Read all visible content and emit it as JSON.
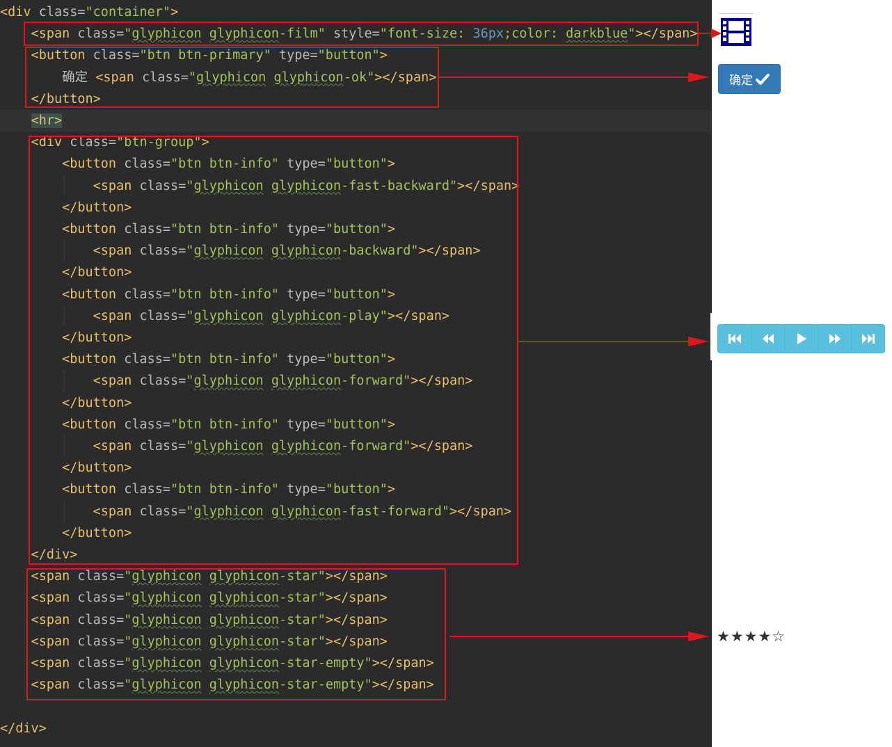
{
  "code_lines": [
    [
      [
        "t",
        "<div "
      ],
      [
        "a",
        "class="
      ],
      [
        "s",
        "\"container\""
      ],
      [
        "t",
        ">"
      ]
    ],
    [
      [
        "t",
        "    <span "
      ],
      [
        "a",
        "class="
      ],
      [
        "s",
        "\""
      ],
      [
        "sw",
        "glyphicon"
      ],
      [
        "s",
        " "
      ],
      [
        "sw",
        "glyphicon"
      ],
      [
        "s",
        "-film\""
      ],
      [
        "a",
        " style="
      ],
      [
        "s",
        "\"font-size: "
      ],
      [
        "n",
        "36px"
      ],
      [
        "s",
        ";color: "
      ],
      [
        "sw",
        "darkblue"
      ],
      [
        "s",
        "\""
      ],
      [
        "t",
        "></span>"
      ]
    ],
    [
      [
        "t",
        "    <button "
      ],
      [
        "a",
        "class="
      ],
      [
        "s",
        "\"btn btn-primary\""
      ],
      [
        "a",
        " type="
      ],
      [
        "s",
        "\"button\""
      ],
      [
        "t",
        ">"
      ]
    ],
    [
      [
        "p",
        "        确定 "
      ],
      [
        "t",
        "<span "
      ],
      [
        "a",
        "class="
      ],
      [
        "s",
        "\""
      ],
      [
        "sw",
        "glyphicon"
      ],
      [
        "s",
        " "
      ],
      [
        "sw",
        "glyphicon"
      ],
      [
        "s",
        "-ok\""
      ],
      [
        "t",
        "></span>"
      ]
    ],
    [
      [
        "t",
        "    </button>"
      ]
    ],
    [
      [
        "p",
        "    "
      ],
      [
        "hr",
        "<hr>"
      ]
    ],
    [
      [
        "t",
        "    <div "
      ],
      [
        "a",
        "class="
      ],
      [
        "s",
        "\"btn-group\""
      ],
      [
        "t",
        ">"
      ]
    ],
    [
      [
        "t",
        "        <button "
      ],
      [
        "a",
        "class="
      ],
      [
        "s",
        "\"btn btn-info\""
      ],
      [
        "a",
        " type="
      ],
      [
        "s",
        "\"button\""
      ],
      [
        "t",
        ">"
      ]
    ],
    [
      [
        "t",
        "            <span "
      ],
      [
        "a",
        "class="
      ],
      [
        "s",
        "\""
      ],
      [
        "sw",
        "glyphicon"
      ],
      [
        "s",
        " "
      ],
      [
        "sw",
        "glyphicon"
      ],
      [
        "s",
        "-fast-backward\""
      ],
      [
        "t",
        "></span>"
      ]
    ],
    [
      [
        "t",
        "        </button>"
      ]
    ],
    [
      [
        "t",
        "        <button "
      ],
      [
        "a",
        "class="
      ],
      [
        "s",
        "\"btn btn-info\""
      ],
      [
        "a",
        " type="
      ],
      [
        "s",
        "\"button\""
      ],
      [
        "t",
        ">"
      ]
    ],
    [
      [
        "t",
        "            <span "
      ],
      [
        "a",
        "class="
      ],
      [
        "s",
        "\""
      ],
      [
        "sw",
        "glyphicon"
      ],
      [
        "s",
        " "
      ],
      [
        "sw",
        "glyphicon"
      ],
      [
        "s",
        "-backward\""
      ],
      [
        "t",
        "></span>"
      ]
    ],
    [
      [
        "t",
        "        </button>"
      ]
    ],
    [
      [
        "t",
        "        <button "
      ],
      [
        "a",
        "class="
      ],
      [
        "s",
        "\"btn btn-info\""
      ],
      [
        "a",
        " type="
      ],
      [
        "s",
        "\"button\""
      ],
      [
        "t",
        ">"
      ]
    ],
    [
      [
        "t",
        "            <span "
      ],
      [
        "a",
        "class="
      ],
      [
        "s",
        "\""
      ],
      [
        "sw",
        "glyphicon"
      ],
      [
        "s",
        " "
      ],
      [
        "sw",
        "glyphicon"
      ],
      [
        "s",
        "-play\""
      ],
      [
        "t",
        "></span>"
      ]
    ],
    [
      [
        "t",
        "        </button>"
      ]
    ],
    [
      [
        "t",
        "        <button "
      ],
      [
        "a",
        "class="
      ],
      [
        "s",
        "\"btn btn-info\""
      ],
      [
        "a",
        " type="
      ],
      [
        "s",
        "\"button\""
      ],
      [
        "t",
        ">"
      ]
    ],
    [
      [
        "t",
        "            <span "
      ],
      [
        "a",
        "class="
      ],
      [
        "s",
        "\""
      ],
      [
        "sw",
        "glyphicon"
      ],
      [
        "s",
        " "
      ],
      [
        "sw",
        "glyphicon"
      ],
      [
        "s",
        "-forward\""
      ],
      [
        "t",
        "></span>"
      ]
    ],
    [
      [
        "t",
        "        </button>"
      ]
    ],
    [
      [
        "t",
        "        <button "
      ],
      [
        "a",
        "class="
      ],
      [
        "s",
        "\"btn btn-info\""
      ],
      [
        "a",
        " type="
      ],
      [
        "s",
        "\"button\""
      ],
      [
        "t",
        ">"
      ]
    ],
    [
      [
        "t",
        "            <span "
      ],
      [
        "a",
        "class="
      ],
      [
        "s",
        "\""
      ],
      [
        "sw",
        "glyphicon"
      ],
      [
        "s",
        " "
      ],
      [
        "sw",
        "glyphicon"
      ],
      [
        "s",
        "-forward\""
      ],
      [
        "t",
        "></span>"
      ]
    ],
    [
      [
        "t",
        "        </button>"
      ]
    ],
    [
      [
        "t",
        "        <button "
      ],
      [
        "a",
        "class="
      ],
      [
        "s",
        "\"btn btn-info\""
      ],
      [
        "a",
        " type="
      ],
      [
        "s",
        "\"button\""
      ],
      [
        "t",
        ">"
      ]
    ],
    [
      [
        "t",
        "            <span "
      ],
      [
        "a",
        "class="
      ],
      [
        "s",
        "\""
      ],
      [
        "sw",
        "glyphicon"
      ],
      [
        "s",
        " "
      ],
      [
        "sw",
        "glyphicon"
      ],
      [
        "s",
        "-fast-forward\""
      ],
      [
        "t",
        "></span>"
      ]
    ],
    [
      [
        "t",
        "        </button>"
      ]
    ],
    [
      [
        "t",
        "    </div>"
      ]
    ],
    [
      [
        "t",
        "    <span "
      ],
      [
        "a",
        "class="
      ],
      [
        "s",
        "\""
      ],
      [
        "sw",
        "glyphicon"
      ],
      [
        "s",
        " "
      ],
      [
        "sw",
        "glyphicon"
      ],
      [
        "s",
        "-star\""
      ],
      [
        "t",
        "></span>"
      ]
    ],
    [
      [
        "t",
        "    <span "
      ],
      [
        "a",
        "class="
      ],
      [
        "s",
        "\""
      ],
      [
        "sw",
        "glyphicon"
      ],
      [
        "s",
        " "
      ],
      [
        "sw",
        "glyphicon"
      ],
      [
        "s",
        "-star\""
      ],
      [
        "t",
        "></span>"
      ]
    ],
    [
      [
        "t",
        "    <span "
      ],
      [
        "a",
        "class="
      ],
      [
        "s",
        "\""
      ],
      [
        "sw",
        "glyphicon"
      ],
      [
        "s",
        " "
      ],
      [
        "sw",
        "glyphicon"
      ],
      [
        "s",
        "-star\""
      ],
      [
        "t",
        "></span>"
      ]
    ],
    [
      [
        "t",
        "    <span "
      ],
      [
        "a",
        "class="
      ],
      [
        "s",
        "\""
      ],
      [
        "sw",
        "glyphicon"
      ],
      [
        "s",
        " "
      ],
      [
        "sw",
        "glyphicon"
      ],
      [
        "s",
        "-star\""
      ],
      [
        "t",
        "></span>"
      ]
    ],
    [
      [
        "t",
        "    <span "
      ],
      [
        "a",
        "class="
      ],
      [
        "s",
        "\""
      ],
      [
        "sw",
        "glyphicon"
      ],
      [
        "s",
        " "
      ],
      [
        "sw",
        "glyphicon"
      ],
      [
        "s",
        "-star-empty\""
      ],
      [
        "t",
        "></span>"
      ]
    ],
    [
      [
        "t",
        "    <span "
      ],
      [
        "a",
        "class="
      ],
      [
        "s",
        "\""
      ],
      [
        "sw",
        "glyphicon"
      ],
      [
        "s",
        " "
      ],
      [
        "sw",
        "glyphicon"
      ],
      [
        "s",
        "-star-empty\""
      ],
      [
        "t",
        "></span>"
      ]
    ],
    [],
    [
      [
        "t",
        "</div>"
      ]
    ]
  ],
  "highlighted_line": 5,
  "preview": {
    "film_icon": "film-icon",
    "film_color": "#00008b",
    "ok_button_label": "确定",
    "ok_icon": "checkmark-icon",
    "media_buttons": [
      {
        "icon": "fast-backward-icon"
      },
      {
        "icon": "backward-icon"
      },
      {
        "icon": "play-icon"
      },
      {
        "icon": "forward-icon"
      },
      {
        "icon": "fast-forward-icon"
      }
    ],
    "stars": "★★★★☆"
  },
  "colors": {
    "editor_bg": "#2b2b2b",
    "annotation_red": "#e0161a",
    "btn_primary": "#337ab7",
    "btn_info": "#5bc0de"
  }
}
